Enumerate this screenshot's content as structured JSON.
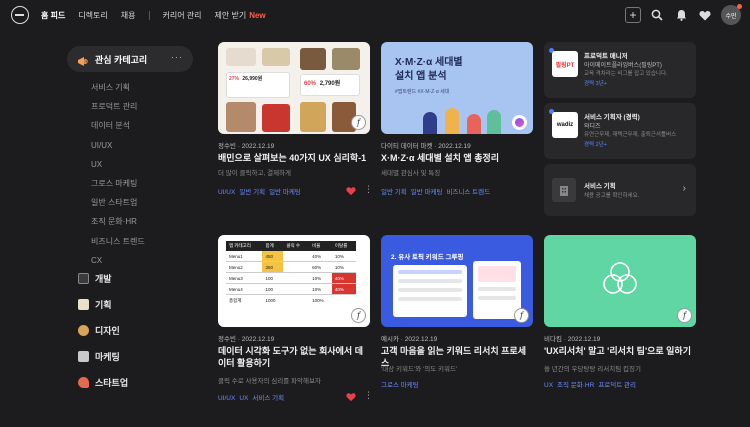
{
  "nav": {
    "items": [
      "홈 피드",
      "디렉토리",
      "채용",
      "커리어 관리",
      "제안 받기"
    ],
    "new_badge": "New",
    "avatar_label": "수민"
  },
  "sidebar": {
    "header": "관심 카테고리",
    "more": "···",
    "sub_items": [
      "서비스 기획",
      "프로덕트 관리",
      "데이터 분석",
      "UI/UX",
      "UX",
      "그로스 마케팅",
      "일반 스타트업",
      "조직 문화·HR",
      "비즈니스 트렌드",
      "CX"
    ],
    "categories": [
      "개발",
      "기획",
      "디자인",
      "마케팅",
      "스타트업"
    ]
  },
  "cards": [
    {
      "author": "정수빈",
      "date": "2022.12.19",
      "title": "배민으로 살펴보는 40가지 UX 심리학-1",
      "desc": "더 많이 클릭하고, 결제하게",
      "tags": [
        "UI/UX",
        "일반 기획",
        "일반 마케팅"
      ],
      "thumb_texts": [
        "60%",
        "2,790원",
        "26,990원",
        "27%"
      ]
    },
    {
      "author": "다이티 데이터 마켓",
      "date": "2022.12.19",
      "title": "X·M·Z·α 세대별 설치 앱 총정리",
      "desc": "세대별 관심사 및 특징",
      "tags": [
        "일반 기획",
        "일반 마케팅",
        "비즈니스 트렌드"
      ],
      "thumb_title": "X·M·Z·α 세대별\n설치 앱 분석",
      "thumb_sub": "#앱트렌드 #X·M·Z·α 세대"
    },
    {
      "author": "정수빈",
      "date": "2022.12.19",
      "title": "데이터 시각화 도구가 없는 회사에서 데이터 활용하기",
      "desc": "클릭 수로 사용자의 심리를 파악해보자",
      "tags": [
        "UI/UX",
        "UX",
        "서비스 기획"
      ],
      "thumb_headers": [
        "앱 카테고리",
        "합계",
        "클릭 수",
        "비율",
        "이탈률"
      ],
      "thumb_rows": [
        [
          "Menu1",
          "450",
          "40%",
          "10%"
        ],
        [
          "Menu2",
          "350",
          "60%",
          "10%"
        ],
        [
          "Menu3",
          "100",
          "10%",
          "40%"
        ],
        [
          "Menu4",
          "100",
          "10%",
          "40%"
        ],
        [
          "총합계",
          "1000",
          "100%",
          ""
        ]
      ]
    },
    {
      "author": "예시카",
      "date": "2022.12.19",
      "title": "고객 마음을 읽는 키워드 리서치 프로세스",
      "desc": "'대상 키워드'와 '의도 키워드'",
      "tags": [
        "그로스 마케팅"
      ],
      "thumb_title": "2. 유사 토픽 키워드 그루핑"
    },
    {
      "author": "비다킴",
      "date": "2022.12.19",
      "title": "'UX리서처' 말고 '리서치 팀'으로 일하기",
      "desc": "쓸 년간의 우당탕탕 리서치팀 킵징기",
      "tags": [
        "UX",
        "조직 문화·HR",
        "프로덕트 관리"
      ]
    }
  ],
  "right_panel": [
    {
      "logo": "필링PT",
      "title": "프로덕트 매니저",
      "company": "아이메이트플라잉버스(필링PT)",
      "desc": "교육 격차라는 비그를 잡고 있습니다.",
      "meta": "경력 3년+"
    },
    {
      "logo": "wadiz",
      "title": "서비스 기획자 (경력)",
      "company": "와디즈",
      "desc": "유연근무제, 재택근무제, 출퇴근셔틀버스",
      "meta": "경력 2년+"
    },
    {
      "title": "서비스 기획",
      "desc": "채용 공고를 확인하세요."
    }
  ],
  "colors": {
    "background": "#1c1c1e",
    "tag": "#6b8cff",
    "heart": "#e8414e",
    "new": "#ff5f4a",
    "thumb_green": "#5fd6a3",
    "thumb_blue": "#a8c4f0"
  }
}
